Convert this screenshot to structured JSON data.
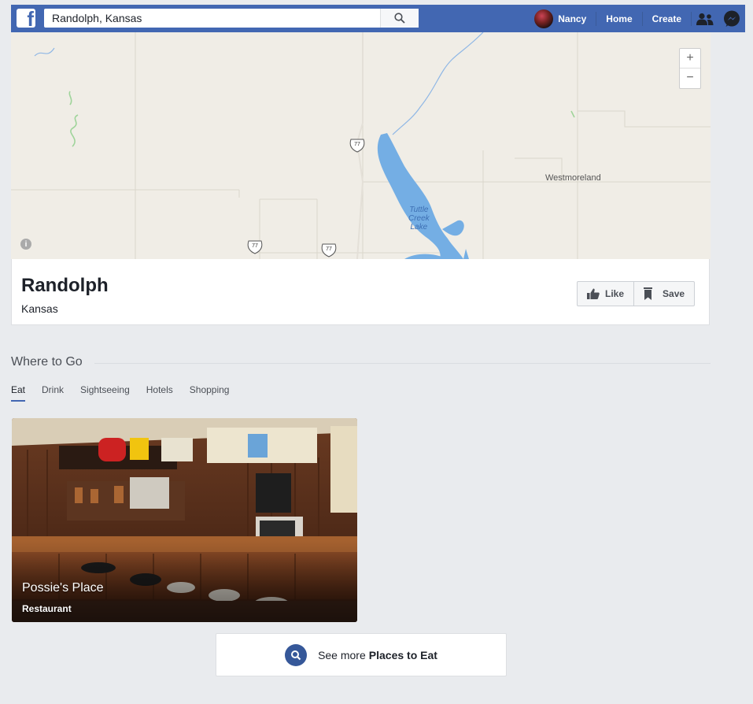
{
  "topbar": {
    "logo": "f",
    "search_value": "Randolph, Kansas",
    "search_placeholder": "Search",
    "user_name": "Nancy",
    "home_label": "Home",
    "create_label": "Create",
    "brand_color": "#4267b2",
    "icons": [
      "facebook-logo-icon",
      "search-icon",
      "friends-icon",
      "messenger-icon"
    ]
  },
  "map": {
    "place_labels": [
      "Westmoreland"
    ],
    "lake_label": [
      "Tuttle",
      "Creek",
      "Lake"
    ],
    "route_shields": [
      "77",
      "77",
      "77"
    ],
    "zoom_in": "+",
    "zoom_out": "−",
    "info": "i"
  },
  "place": {
    "title": "Randolph",
    "subtitle": "Kansas",
    "like_label": "Like",
    "save_label": "Save"
  },
  "where_to_go": {
    "title": "Where to Go",
    "tabs": [
      "Eat",
      "Drink",
      "Sightseeing",
      "Hotels",
      "Shopping"
    ],
    "active_tab": "Eat",
    "card": {
      "name": "Possie's Place",
      "category": "Restaurant"
    },
    "see_more_prefix": "See more",
    "see_more_bold": "Places to Eat"
  }
}
